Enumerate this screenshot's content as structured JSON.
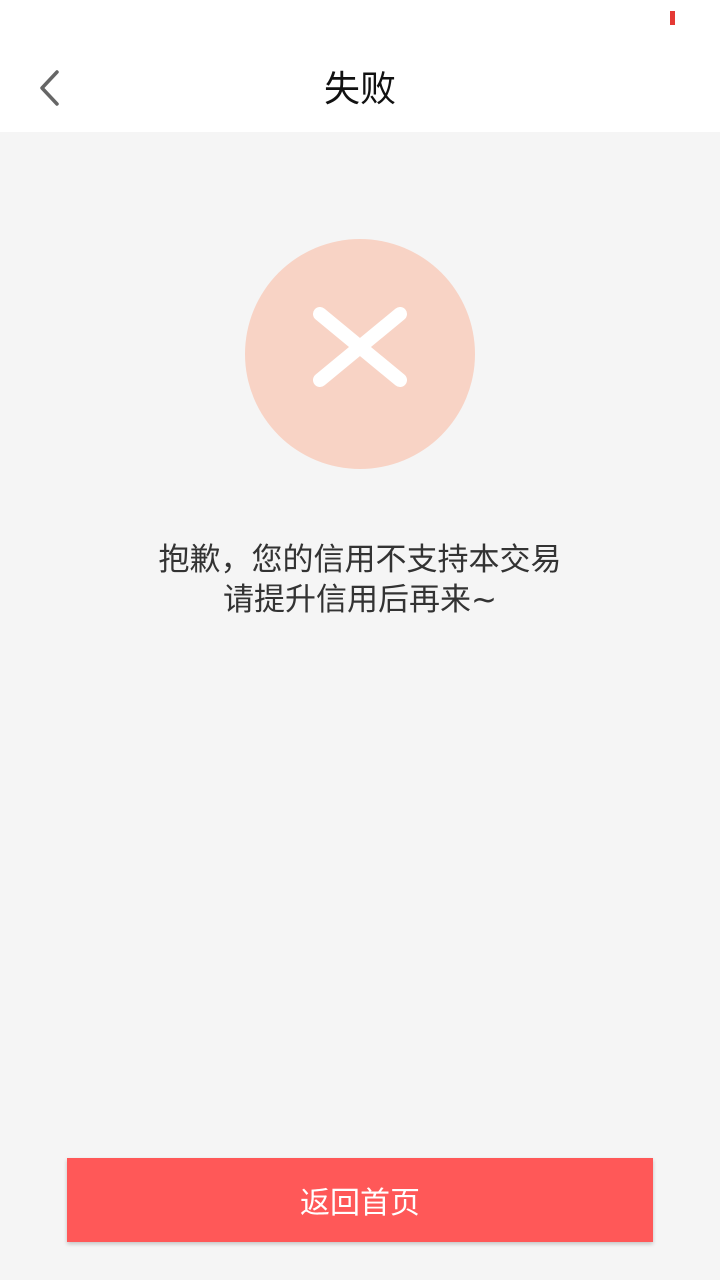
{
  "header": {
    "title": "失败",
    "back_icon": "chevron-left-icon"
  },
  "result": {
    "icon": "close-icon",
    "circle_color": "#f8d3c5",
    "message_line1": "抱歉，您的信用不支持本交易",
    "message_line2": "请提升信用后再来~"
  },
  "actions": {
    "home_label": "返回首页",
    "button_color": "#ff5858"
  }
}
